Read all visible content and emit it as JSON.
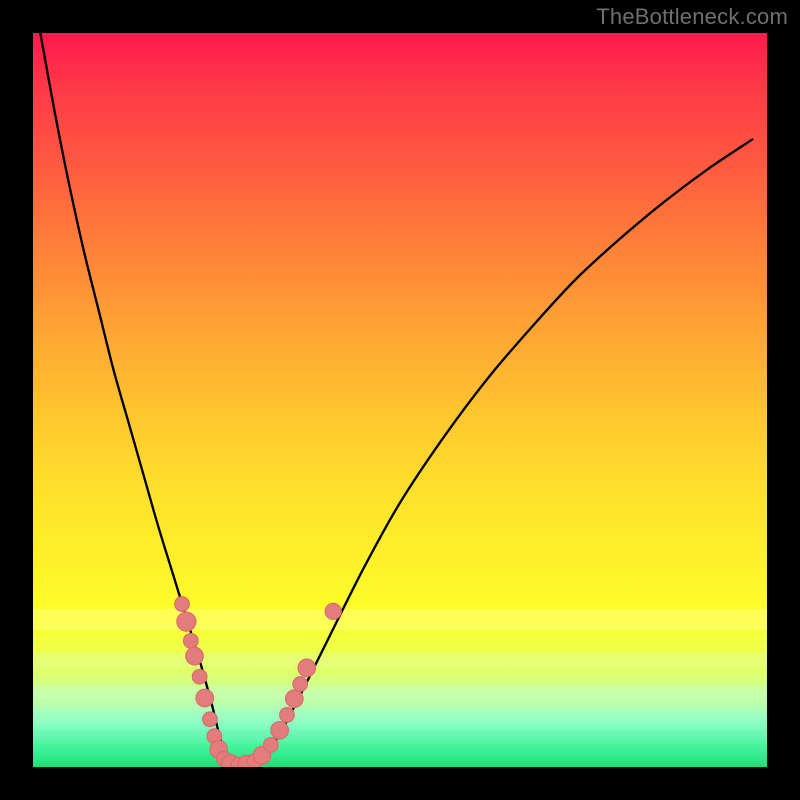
{
  "watermark": "TheBottleneck.com",
  "colors": {
    "frame": "#000000",
    "curve": "#000000",
    "dots": "#e37d7d",
    "dots_stroke": "#d86a6a"
  },
  "chart_data": {
    "type": "line",
    "title": "",
    "xlabel": "",
    "ylabel": "",
    "xlim": [
      0,
      100
    ],
    "ylim": [
      0,
      100
    ],
    "grid": false,
    "legend": false,
    "series": [
      {
        "name": "bottleneck-curve",
        "x": [
          1,
          3,
          5,
          7,
          9,
          11,
          13,
          15,
          17,
          19,
          21,
          23,
          24.5,
          25.8,
          27.5,
          30,
          33,
          36,
          40,
          45,
          50,
          56,
          62,
          68,
          74,
          80,
          86,
          92,
          98
        ],
        "y": [
          100,
          89,
          79,
          70,
          62,
          54,
          47,
          40,
          33,
          26.5,
          20,
          13.5,
          8,
          3,
          0.5,
          0.6,
          3.5,
          9,
          17,
          27,
          36,
          45,
          53,
          60,
          66.5,
          72,
          77,
          81.5,
          85.5
        ]
      }
    ],
    "annotations": {
      "dots": [
        {
          "x": 20.3,
          "y": 22.2,
          "r": 1.0
        },
        {
          "x": 20.9,
          "y": 19.8,
          "r": 1.3
        },
        {
          "x": 21.5,
          "y": 17.2,
          "r": 1.0
        },
        {
          "x": 22.0,
          "y": 15.1,
          "r": 1.2
        },
        {
          "x": 22.7,
          "y": 12.3,
          "r": 1.0
        },
        {
          "x": 23.4,
          "y": 9.4,
          "r": 1.2
        },
        {
          "x": 24.1,
          "y": 6.5,
          "r": 1.0
        },
        {
          "x": 24.7,
          "y": 4.2,
          "r": 1.0
        },
        {
          "x": 25.3,
          "y": 2.4,
          "r": 1.2
        },
        {
          "x": 26.0,
          "y": 1.1,
          "r": 1.0
        },
        {
          "x": 26.9,
          "y": 0.5,
          "r": 1.2
        },
        {
          "x": 28.0,
          "y": 0.3,
          "r": 1.0
        },
        {
          "x": 29.1,
          "y": 0.4,
          "r": 1.2
        },
        {
          "x": 30.2,
          "y": 0.8,
          "r": 1.0
        },
        {
          "x": 31.2,
          "y": 1.6,
          "r": 1.2
        },
        {
          "x": 32.4,
          "y": 3.0,
          "r": 1.0
        },
        {
          "x": 33.6,
          "y": 5.0,
          "r": 1.2
        },
        {
          "x": 34.6,
          "y": 7.1,
          "r": 1.0
        },
        {
          "x": 35.6,
          "y": 9.3,
          "r": 1.2
        },
        {
          "x": 36.4,
          "y": 11.3,
          "r": 1.0
        },
        {
          "x": 37.3,
          "y": 13.5,
          "r": 1.2
        },
        {
          "x": 40.9,
          "y": 21.2,
          "r": 1.1
        }
      ]
    },
    "background_gradient": {
      "direction": "top-to-bottom",
      "stops": [
        {
          "pos": 0.0,
          "color": "#ff1a4d"
        },
        {
          "pos": 0.18,
          "color": "#ff5a40"
        },
        {
          "pos": 0.4,
          "color": "#ffa334"
        },
        {
          "pos": 0.62,
          "color": "#ffe02c"
        },
        {
          "pos": 0.8,
          "color": "#fdff2a"
        },
        {
          "pos": 0.94,
          "color": "#8cffc4"
        },
        {
          "pos": 1.0,
          "color": "#1be07a"
        }
      ]
    }
  }
}
